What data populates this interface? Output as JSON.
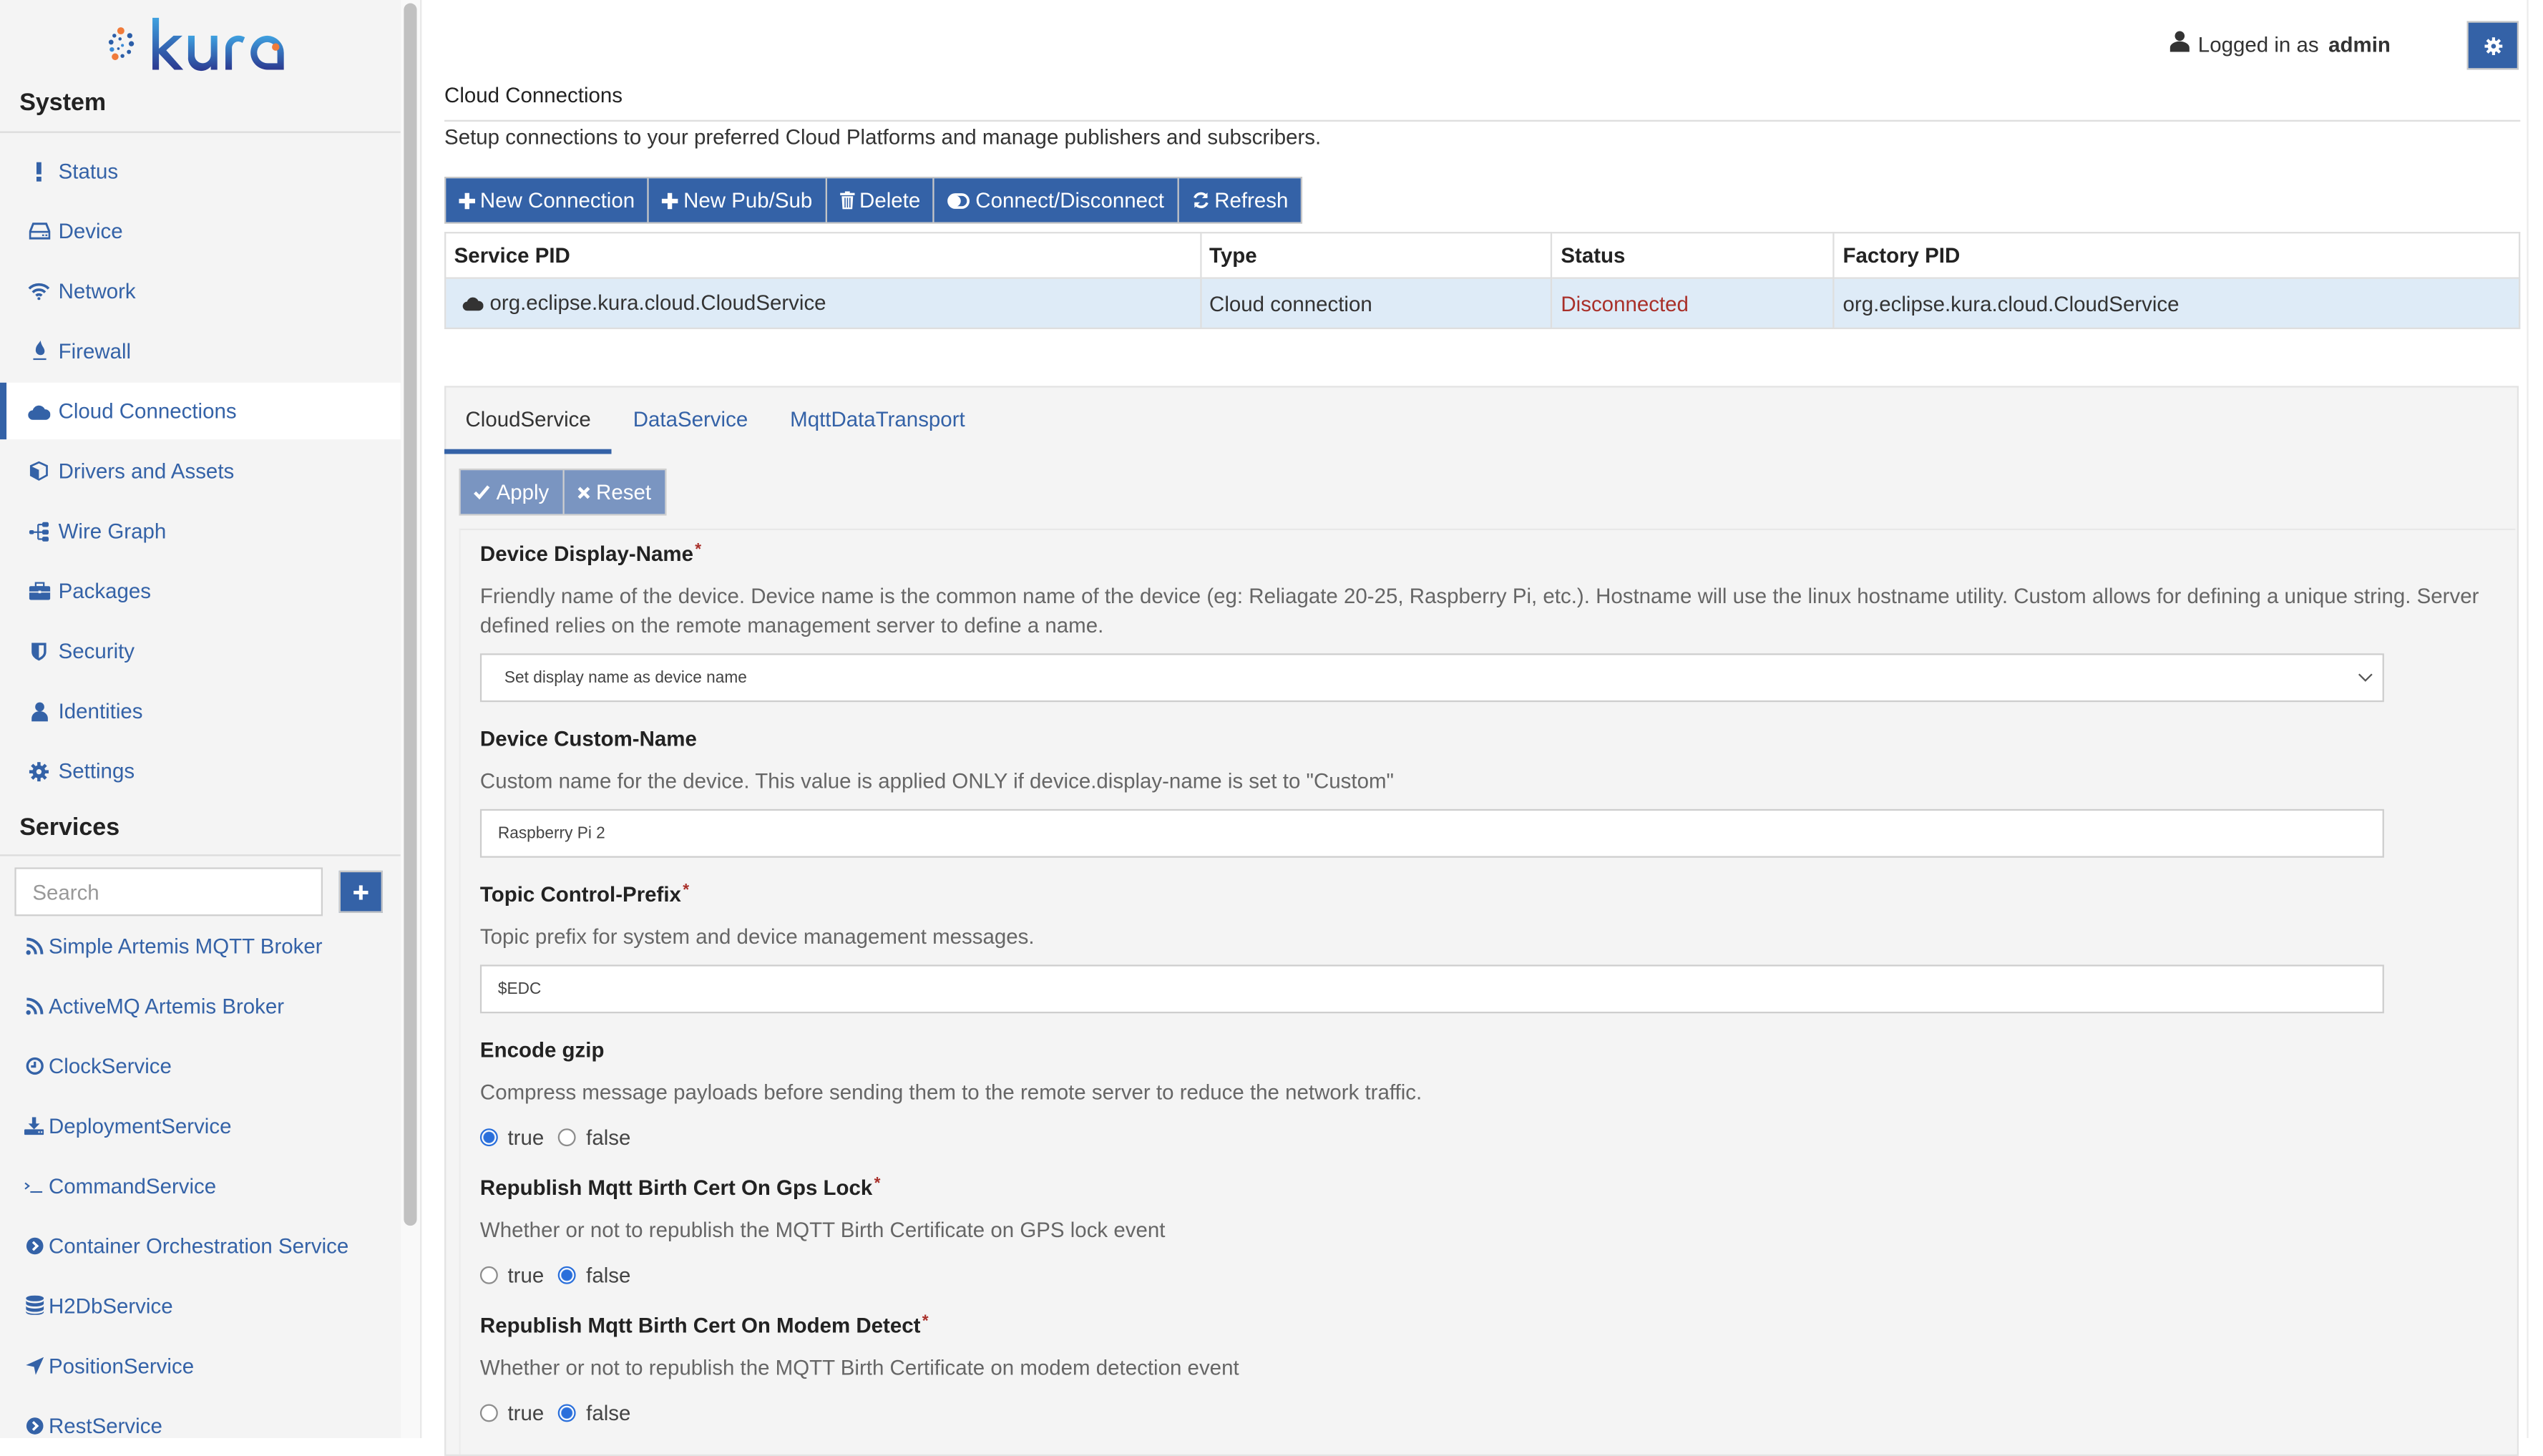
{
  "app": {
    "logo_text": "kura"
  },
  "sidebar": {
    "system_title": "System",
    "system_items": [
      {
        "label": "Status",
        "icon": "exclamation-icon"
      },
      {
        "label": "Device",
        "icon": "hdd-icon"
      },
      {
        "label": "Network",
        "icon": "wifi-icon"
      },
      {
        "label": "Firewall",
        "icon": "fire-icon"
      },
      {
        "label": "Cloud Connections",
        "icon": "cloud-icon",
        "active": true
      },
      {
        "label": "Drivers and Assets",
        "icon": "cube-icon"
      },
      {
        "label": "Wire Graph",
        "icon": "sitemap-icon"
      },
      {
        "label": "Packages",
        "icon": "briefcase-icon"
      },
      {
        "label": "Security",
        "icon": "shield-icon"
      },
      {
        "label": "Identities",
        "icon": "user-icon"
      },
      {
        "label": "Settings",
        "icon": "gear-icon"
      }
    ],
    "services_title": "Services",
    "search_placeholder": "Search",
    "add_service_label": "+",
    "services": [
      {
        "label": "Simple Artemis MQTT Broker",
        "icon": "rss-icon"
      },
      {
        "label": "ActiveMQ Artemis Broker",
        "icon": "rss-icon"
      },
      {
        "label": "ClockService",
        "icon": "clock-icon"
      },
      {
        "label": "DeploymentService",
        "icon": "download-icon"
      },
      {
        "label": "CommandService",
        "icon": "terminal-icon"
      },
      {
        "label": "Container Orchestration Service",
        "icon": "chevron-circle-right-icon"
      },
      {
        "label": "H2DbService",
        "icon": "database-icon"
      },
      {
        "label": "PositionService",
        "icon": "location-arrow-icon"
      },
      {
        "label": "RestService",
        "icon": "chevron-circle-right-icon"
      }
    ]
  },
  "header": {
    "logged_in_prefix": "Logged in as",
    "username": "admin"
  },
  "page": {
    "title": "Cloud Connections",
    "description": "Setup connections to your preferred Cloud Platforms and manage publishers and subscribers."
  },
  "toolbar": {
    "new_connection": "New Connection",
    "new_pubsub": "New Pub/Sub",
    "delete": "Delete",
    "connect_disconnect": "Connect/Disconnect",
    "refresh": "Refresh"
  },
  "table": {
    "columns": [
      "Service PID",
      "Type",
      "Status",
      "Factory PID"
    ],
    "rows": [
      {
        "service_pid": "org.eclipse.kura.cloud.CloudService",
        "type": "Cloud connection",
        "status": "Disconnected",
        "factory_pid": "org.eclipse.kura.cloud.CloudService"
      }
    ]
  },
  "tabs": [
    {
      "label": "CloudService",
      "active": true
    },
    {
      "label": "DataService",
      "active": false
    },
    {
      "label": "MqttDataTransport",
      "active": false
    }
  ],
  "actions": {
    "apply": "Apply",
    "reset": "Reset"
  },
  "form": {
    "required_marker": "*",
    "fields": [
      {
        "label": "Device Display-Name",
        "required": true,
        "description": "Friendly name of the device. Device name is the common name of the device (eg: Reliagate 20-25, Raspberry Pi, etc.). Hostname will use the linux hostname utility. Custom allows for defining a unique string. Server defined relies on the remote management server to define a name.",
        "type": "select",
        "value": "Set display name as device name"
      },
      {
        "label": "Device Custom-Name",
        "required": false,
        "description": "Custom name for the device. This value is applied ONLY if device.display-name is set to \"Custom\"",
        "type": "text",
        "value": "Raspberry Pi 2"
      },
      {
        "label": "Topic Control-Prefix",
        "required": true,
        "description": "Topic prefix for system and device management messages.",
        "type": "text",
        "value": "$EDC"
      },
      {
        "label": "Encode gzip",
        "required": false,
        "description": "Compress message payloads before sending them to the remote server to reduce the network traffic.",
        "type": "radio",
        "options": [
          "true",
          "false"
        ],
        "value": "true"
      },
      {
        "label": "Republish Mqtt Birth Cert On Gps Lock",
        "required": true,
        "description": "Whether or not to republish the MQTT Birth Certificate on GPS lock event",
        "type": "radio",
        "options": [
          "true",
          "false"
        ],
        "value": "false"
      },
      {
        "label": "Republish Mqtt Birth Cert On Modem Detect",
        "required": true,
        "description": "Whether or not to republish the MQTT Birth Certificate on modem detection event",
        "type": "radio",
        "options": [
          "true",
          "false"
        ],
        "value": "false"
      }
    ]
  },
  "colors": {
    "primary": "#3462a7",
    "primary_disabled": "#7a95c1",
    "sidebar_bg": "#f4f4f4",
    "selected_row_bg": "#deebf7",
    "status_disconnected": "#a9302a",
    "required_marker": "#a9302a",
    "radio_checked": "#2a6fdb"
  }
}
